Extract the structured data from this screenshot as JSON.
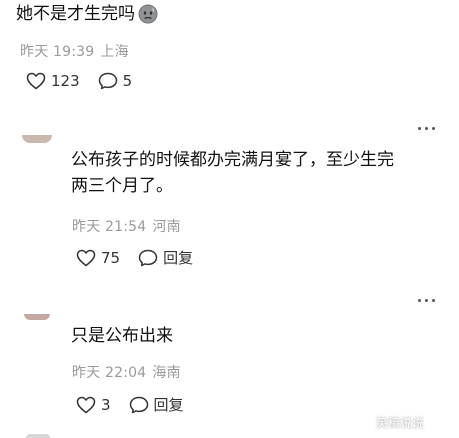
{
  "post": {
    "text": "她不是才生完吗",
    "emoji_icon": "sweat-face-emoji-icon",
    "time": "昨天 19:39",
    "location": "上海",
    "likes": "123",
    "comments": "5"
  },
  "replies": [
    {
      "text_line1": "公布孩子的时候都办完满月宴了，至少生完",
      "text_line2": "两三个月了。",
      "time": "昨天 21:54",
      "location": "河南",
      "likes": "75",
      "reply_label": "回复"
    },
    {
      "text_line1": "只是公布出来",
      "time": "昨天 22:04",
      "location": "海南",
      "likes": "3",
      "reply_label": "回复"
    }
  ],
  "watermark": "笑稿说说",
  "colors": {
    "text": "#111111",
    "meta": "#9a9a9a",
    "icon": "#333333"
  },
  "icons": [
    "heart-outline-icon",
    "comment-bubble-icon",
    "more-dots-icon"
  ]
}
